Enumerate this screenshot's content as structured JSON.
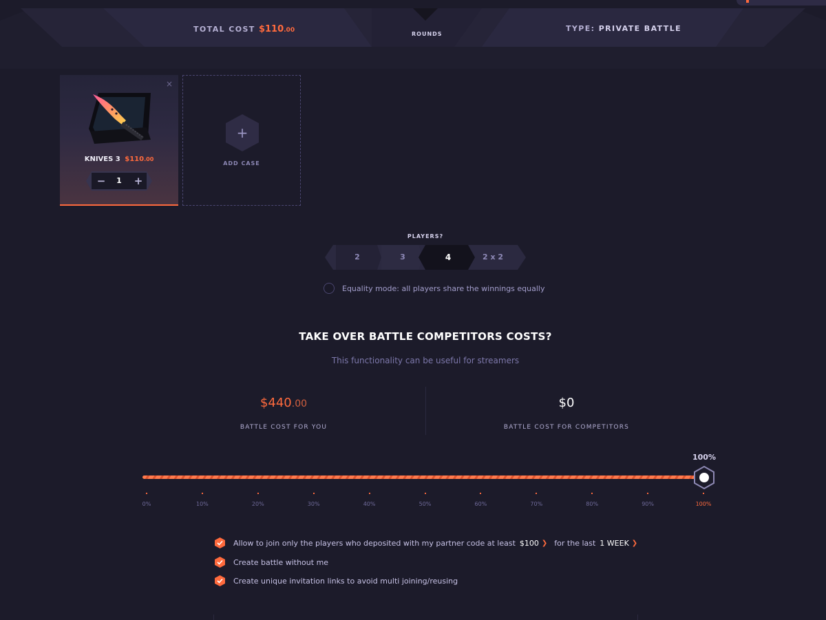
{
  "header": {
    "total_cost_label": "TOTAL COST",
    "total_cost_dollars": "$110",
    "total_cost_cents": ".00",
    "rounds_label": "ROUNDS",
    "type_label": "TYPE:",
    "type_value": "PRIVATE BATTLE"
  },
  "case_card": {
    "close": "×",
    "name": "KNIVES 3",
    "price_dollars": "$110",
    "price_cents": ".00",
    "quantity": "1",
    "minus": "−",
    "plus": "+",
    "icon": "knife-case-image"
  },
  "add_case": {
    "plus": "+",
    "label": "ADD CASE"
  },
  "players": {
    "label": "PLAYERS?",
    "options": [
      "2",
      "3",
      "4",
      "2 x 2"
    ],
    "selected": "4",
    "equality_text": "Equality mode: all players share the winnings equally"
  },
  "takeover": {
    "title": "TAKE OVER BATTLE COMPETITORS COSTS?",
    "subtitle": "This functionality can be useful for streamers",
    "you_cost_dollars": "$440",
    "you_cost_cents": ".00",
    "you_label": "BATTLE COST FOR YOU",
    "competitor_cost": "$0",
    "competitor_label": "BATTLE COST FOR COMPETITORS"
  },
  "slider": {
    "value_percent": 100,
    "readout": "100%",
    "ticks": [
      "0%",
      "10%",
      "20%",
      "30%",
      "40%",
      "50%",
      "60%",
      "70%",
      "80%",
      "90%",
      "100%"
    ]
  },
  "options": {
    "partner_text_before": "Allow to join only the players who deposited with my partner code at least",
    "partner_amount": "$100",
    "partner_text_middle": "for the last",
    "partner_period": "1 WEEK",
    "create_without_me": "Create battle without me",
    "unique_links": "Create unique invitation links to avoid multi joining/reusing"
  },
  "colors": {
    "accent": "#ff6a3d",
    "background": "#1c1b2a",
    "panel": "#242235",
    "muted_text": "#7d78ab"
  }
}
